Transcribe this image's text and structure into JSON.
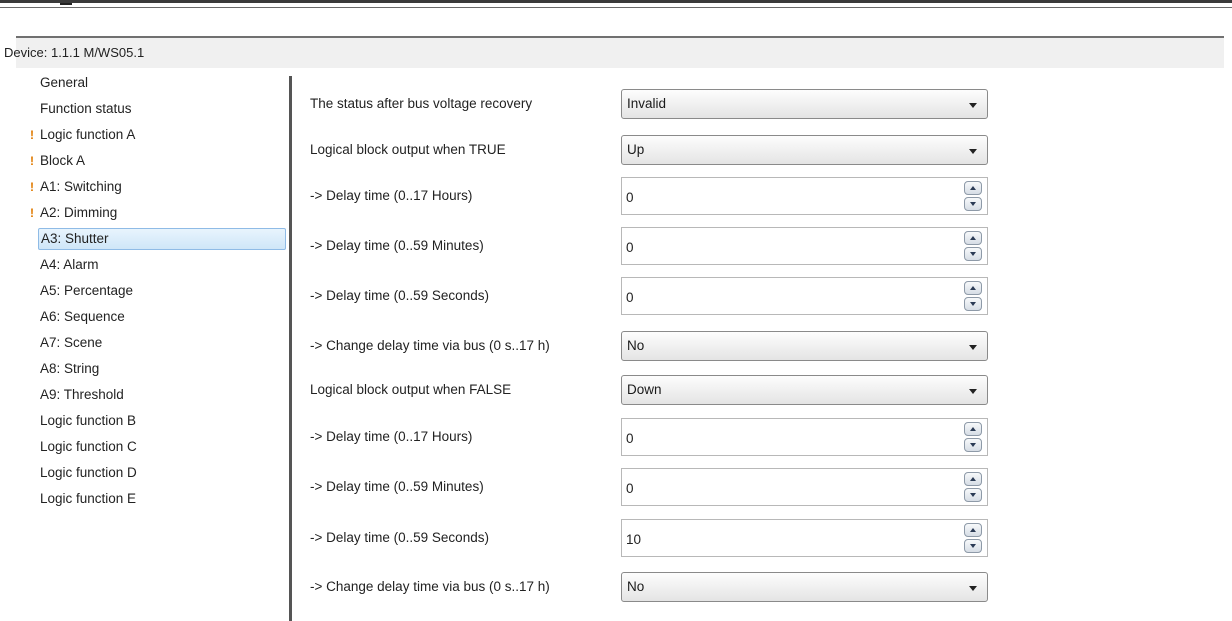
{
  "device_title": "Device: 1.1.1  M/WS05.1",
  "sidebar": {
    "items": [
      {
        "label": "General",
        "warning": false,
        "selected": false
      },
      {
        "label": "Function status",
        "warning": false,
        "selected": false
      },
      {
        "label": "Logic function A",
        "warning": true,
        "selected": false
      },
      {
        "label": "Block A",
        "warning": true,
        "selected": false
      },
      {
        "label": "A1: Switching",
        "warning": true,
        "selected": false
      },
      {
        "label": "A2: Dimming",
        "warning": true,
        "selected": false
      },
      {
        "label": "A3: Shutter",
        "warning": false,
        "selected": true
      },
      {
        "label": "A4: Alarm",
        "warning": false,
        "selected": false
      },
      {
        "label": "A5: Percentage",
        "warning": false,
        "selected": false
      },
      {
        "label": "A6: Sequence",
        "warning": false,
        "selected": false
      },
      {
        "label": "A7: Scene",
        "warning": false,
        "selected": false
      },
      {
        "label": "A8: String",
        "warning": false,
        "selected": false
      },
      {
        "label": "A9: Threshold",
        "warning": false,
        "selected": false
      },
      {
        "label": "Logic function B",
        "warning": false,
        "selected": false
      },
      {
        "label": "Logic function C",
        "warning": false,
        "selected": false
      },
      {
        "label": "Logic function D",
        "warning": false,
        "selected": false
      },
      {
        "label": "Logic function E",
        "warning": false,
        "selected": false
      }
    ],
    "warning_icon": "!"
  },
  "params": [
    {
      "label": "The status after bus voltage recovery",
      "type": "dropdown",
      "value": "Invalid"
    },
    {
      "label": "Logical block output when TRUE",
      "type": "dropdown",
      "value": "Up"
    },
    {
      "label": "-> Delay time (0..17 Hours)",
      "type": "spin",
      "value": "0"
    },
    {
      "label": "-> Delay time (0..59 Minutes)",
      "type": "spin",
      "value": "0"
    },
    {
      "label": "-> Delay time (0..59 Seconds)",
      "type": "spin",
      "value": "0"
    },
    {
      "label": "-> Change delay time via bus (0 s..17 h)",
      "type": "dropdown",
      "value": "No"
    },
    {
      "label": "Logical block output when FALSE",
      "type": "dropdown",
      "value": "Down"
    },
    {
      "label": "-> Delay time (0..17 Hours)",
      "type": "spin",
      "value": "0"
    },
    {
      "label": "-> Delay time (0..59 Minutes)",
      "type": "spin",
      "value": "0"
    },
    {
      "label": "-> Delay time (0..59 Seconds)",
      "type": "spin",
      "value": "10"
    },
    {
      "label": "-> Change delay time via bus (0 s..17 h)",
      "type": "dropdown",
      "value": "No"
    }
  ],
  "colors": {
    "warning": "#e07a00",
    "selection_bg": "#cfe6f8",
    "selection_border": "#8fbbe6",
    "panel_bg": "#f0f0f0"
  },
  "icons": {
    "dropdown": "chevron-down-icon",
    "spin_up": "spin-up-icon",
    "spin_down": "spin-down-icon",
    "warning": "warning-icon"
  }
}
